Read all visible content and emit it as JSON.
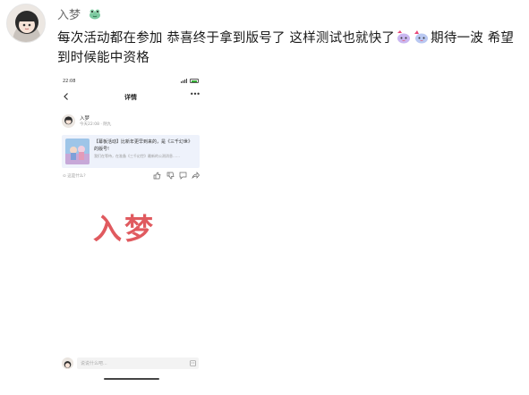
{
  "post": {
    "author": "入梦",
    "text_part1": "每次活动都在参加 恭喜终于拿到版号了 这样测试也就快了",
    "text_part2": "期待一波 希望到时候能中资格"
  },
  "screenshot": {
    "status_time": "22:08",
    "nav_title": "详情",
    "nav_more": "•••",
    "user_name": "入梦",
    "user_meta": "今天22:08 · 阴九",
    "card_title": "【幕板活动】比新年更早到来的，是《三千幻世》的版号!",
    "card_sub": "我们在等待，在准备《三千幻世》最新的公测消息……",
    "actions_left": "⊙ 这是什么？",
    "watermark": "入梦",
    "input_placeholder": "说说什么吧..."
  }
}
